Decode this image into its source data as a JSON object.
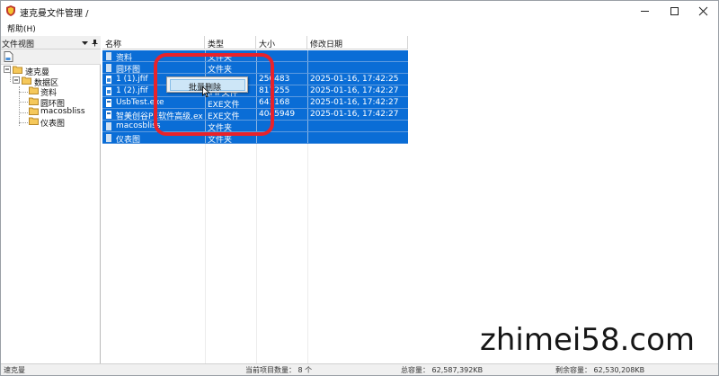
{
  "window": {
    "title": "速克曼文件管理 /"
  },
  "menu": {
    "help_label": "帮助(H)"
  },
  "left_panel": {
    "title": "文件视图",
    "tree": {
      "root": "速克曼",
      "folder": "数据区",
      "children": [
        "资料",
        "圆环图",
        "macosbliss",
        "仪表图"
      ]
    }
  },
  "list": {
    "columns": {
      "name": "名称",
      "type": "类型",
      "size": "大小",
      "modified": "修改日期"
    },
    "rows": [
      {
        "name": "资料",
        "type": "文件夹",
        "size": "",
        "modified": ""
      },
      {
        "name": "圆环图",
        "type": "文件夹",
        "size": "",
        "modified": ""
      },
      {
        "name": "1 (1).jfif",
        "type": "",
        "size": "250483",
        "modified": "2025-01-16, 17:42:25"
      },
      {
        "name": "1 (2).jfif",
        "type": "JFIF文件",
        "size": "817255",
        "modified": "2025-01-16, 17:42:27"
      },
      {
        "name": "UsbTest.exe",
        "type": "EXE文件",
        "size": "641168",
        "modified": "2025-01-16, 17:42:27"
      },
      {
        "name": "智美创谷PE软件高级.exe",
        "type": "EXE文件",
        "size": "4045949",
        "modified": "2025-01-16, 17:42:27"
      },
      {
        "name": "macosbliss",
        "type": "文件夹",
        "size": "",
        "modified": ""
      },
      {
        "name": "仪表图",
        "type": "文件夹",
        "size": "",
        "modified": ""
      }
    ]
  },
  "context_menu": {
    "item": "批量删除"
  },
  "status": {
    "left": "速克曼",
    "count": "当前项目数量： 8 个",
    "total": "总容量： 62,587,392KB",
    "free": "剩余容量： 62,530,208KB"
  },
  "watermark": "zhimei58.com",
  "colors": {
    "selection": "#0a6dd6",
    "annotation": "#e8222b",
    "context_highlight": "#cde6f7"
  }
}
